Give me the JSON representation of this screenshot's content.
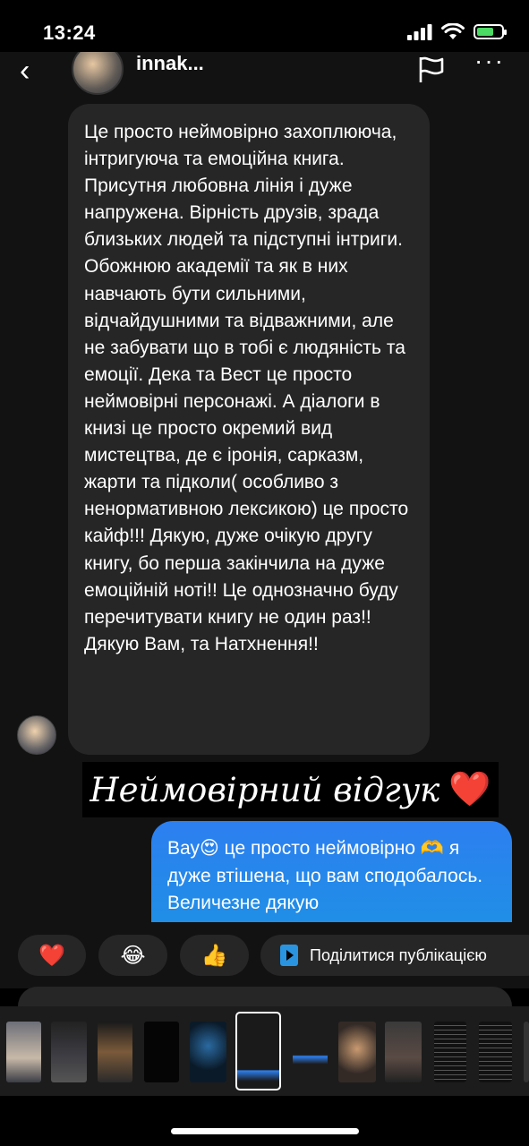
{
  "status_bar": {
    "time": "13:24"
  },
  "header": {
    "contact_name": "innak..."
  },
  "message_in": {
    "text": "Це просто неймовірно захоплююча, інтригуюча та емоційна книга. Присутня любовна лінія і дуже напружена. Вірність друзів, зрада близьких людей та підступні інтриги. Обожнюю академії та як в них навчають бути сильними, відчайдушними та відважними, але не забувати що в тобі є людяність та емоції. Дека та Вест це просто неймовірні персонажі. А діалоги в книзі це просто окремий вид мистецтва, де є іронія, сарказм, жарти та підколи( особливо з ненормативною лексикою) це просто кайф!!! Дякую, дуже очікую другу книгу, бо перша закінчила на дуже емоційній ноті!! Це однозначно буду перечитувати книгу не один раз!! Дякую Вам, та Натхнення!!"
  },
  "caption": {
    "text": "Неймовірний відгук",
    "emoji": "❤️"
  },
  "message_out": {
    "text": "Вау😍 це просто неймовірно 🫶 я дуже втішена, що вам сподобалось. Величезне дякую"
  },
  "quick_actions": {
    "reactions": [
      "❤️",
      "😂",
      "👍"
    ],
    "share_label": "Поділитися публікацією"
  },
  "colors": {
    "background": "#121212",
    "incoming_bubble": "#262626",
    "outgoing_bubble": "#2d7ff0",
    "battery_green": "#4cd964",
    "heart_red": "#e8202e"
  }
}
